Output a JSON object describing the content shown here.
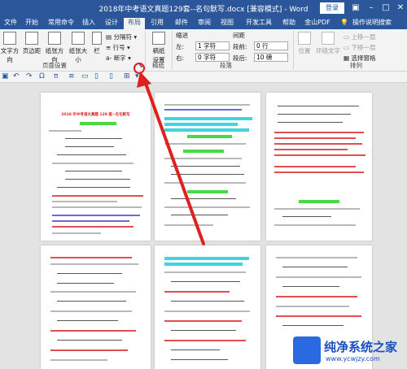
{
  "window": {
    "title": "2018年中考语文真题129套--名句默写.docx [兼容模式] - Word",
    "login_label": "登录",
    "controls": [
      "ribbon-display-icon",
      "minimize-icon",
      "maximize-icon",
      "close-icon"
    ]
  },
  "tabs": [
    {
      "label": "文件",
      "active": false
    },
    {
      "label": "开始",
      "active": false
    },
    {
      "label": "常用命令",
      "active": false
    },
    {
      "label": "插入",
      "active": false
    },
    {
      "label": "设计",
      "active": false
    },
    {
      "label": "布局",
      "active": true
    },
    {
      "label": "引用",
      "active": false
    },
    {
      "label": "邮件",
      "active": false
    },
    {
      "label": "审阅",
      "active": false
    },
    {
      "label": "视图",
      "active": false
    },
    {
      "label": "开发工具",
      "active": false
    },
    {
      "label": "帮助",
      "active": false
    },
    {
      "label": "金山PDF",
      "active": false
    },
    {
      "label": "操作说明搜索",
      "active": false
    }
  ],
  "ribbon": {
    "page_setup": {
      "text_direction": "文字方向",
      "margins": "页边距",
      "orientation": "纸张方向",
      "size": "纸张大小",
      "columns": "栏",
      "breaks": "分隔符",
      "line_numbers": "行号",
      "hyphenation": "断字",
      "group_label": "页面设置"
    },
    "draft": {
      "settings_line1": "稿纸",
      "settings_line2": "设置",
      "group_label": "稿纸"
    },
    "paragraph": {
      "indent_title": "缩进",
      "spacing_title": "间距",
      "left_label": "左:",
      "left_value": "1 字符",
      "right_label": "右:",
      "right_value": "0 字符",
      "before_label": "段前:",
      "before_value": "0 行",
      "after_label": "段后:",
      "after_value": "10 磅",
      "group_label": "段落"
    },
    "arrange": {
      "position": "位置",
      "wrap_text": "环绕文字",
      "bring_forward": "上移一层",
      "send_backward": "下移一层",
      "selection_pane": "选择窗格",
      "group_label": "排列"
    }
  },
  "page_title": "2018 年中考语文真题 129 套--名句默写"
}
